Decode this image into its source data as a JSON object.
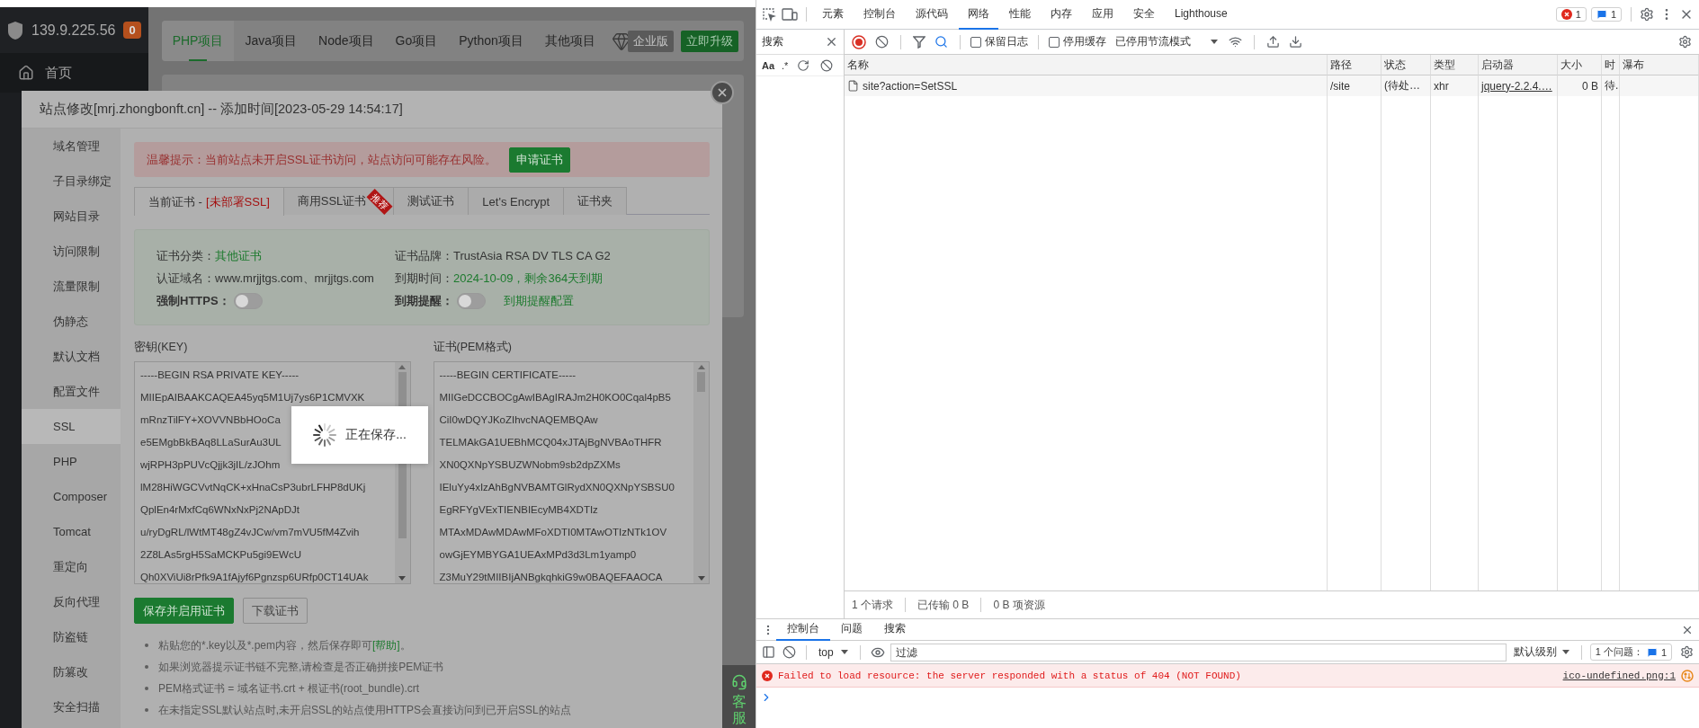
{
  "app": {
    "server_ip": "139.9.225.56",
    "alert_count": "0",
    "nav": [
      {
        "label": "首页"
      }
    ],
    "project_tabs": [
      {
        "label": "PHP项目",
        "selected": true
      },
      {
        "label": "Java项目",
        "selected": false
      },
      {
        "label": "Node项目",
        "selected": false
      },
      {
        "label": "Go项目",
        "selected": false
      },
      {
        "label": "Python项目",
        "selected": false
      },
      {
        "label": "其他项目",
        "selected": false
      }
    ],
    "edition": "企业版",
    "upgrade_button": "立即升级",
    "support": "客服"
  },
  "dialog": {
    "title": "站点修改[mrj.zhongbonft.cn] -- 添加时间[2023-05-29 14:54:17]",
    "menu": [
      {
        "label": "域名管理",
        "selected": false
      },
      {
        "label": "子目录绑定",
        "selected": false
      },
      {
        "label": "网站目录",
        "selected": false
      },
      {
        "label": "访问限制",
        "selected": false
      },
      {
        "label": "流量限制",
        "selected": false
      },
      {
        "label": "伪静态",
        "selected": false
      },
      {
        "label": "默认文档",
        "selected": false
      },
      {
        "label": "配置文件",
        "selected": false
      },
      {
        "label": "SSL",
        "selected": true
      },
      {
        "label": "PHP",
        "selected": false
      },
      {
        "label": "Composer",
        "selected": false
      },
      {
        "label": "Tomcat",
        "selected": false
      },
      {
        "label": "重定向",
        "selected": false
      },
      {
        "label": "反向代理",
        "selected": false
      },
      {
        "label": "防盗链",
        "selected": false
      },
      {
        "label": "防篡改",
        "selected": false
      },
      {
        "label": "安全扫描",
        "selected": false
      }
    ],
    "warning": {
      "text": "温馨提示：当前站点未开启SSL证书访问，站点访问可能存在风险。",
      "button": "申请证书"
    },
    "cert_tabs": [
      {
        "label": "当前证书 -",
        "status": "[未部署SSL]",
        "selected": true
      },
      {
        "label": "商用SSL证书",
        "badge": "推荐",
        "selected": false
      },
      {
        "label": "测试证书",
        "selected": false
      },
      {
        "label": "Let's Encrypt",
        "selected": false
      },
      {
        "label": "证书夹",
        "selected": false
      }
    ],
    "cert_info": [
      {
        "kind": "status",
        "label": "证书分类：",
        "value": "其他证书"
      },
      {
        "kind": "value",
        "label": "证书品牌：",
        "value": "TrustAsia RSA DV TLS CA G2"
      },
      {
        "kind": "value",
        "label": "认证域名：",
        "value": "www.mrjjtgs.com、mrjjtgs.com"
      },
      {
        "kind": "status",
        "label": "到期时间：",
        "value": "2024-10-09，剩余364天到期"
      },
      {
        "kind": "toggle",
        "label": "强制HTTPS：",
        "on": false
      },
      {
        "kind": "toggle",
        "label": "到期提醒：",
        "on": false,
        "link": "到期提醒配置"
      }
    ],
    "key": {
      "label": "密钥(KEY)",
      "lines": [
        "-----BEGIN RSA PRIVATE KEY-----",
        "MIIEpAIBAAKCAQEA45yq5M1Uj7ys6P1CMVXK",
        "mRnzTilFY+XOVVNBbHOoCa",
        "e5EMgbBkBAq8LLaSurAu3UL",
        "wjRPH3pPUVcQjjk3jIL/zJOhm",
        "lM28HiWGCVvtNqCK+xHnaCsP3ubrLFHP8dUKj",
        "QplEn4rMxfCq6WNxNxPj2NApDJt",
        "u/ryDgRL/lWtMT48gZ4vJCw/vm7mVU5fM4Zvih",
        "2Z8LAs5rgH5SaMCKPu5gi9EWcU",
        "Qh0XViUi8rPfk9A1fAjyf6Pgnzsp6URfp0CT14UAk"
      ]
    },
    "certificate": {
      "label": "证书(PEM格式)",
      "lines": [
        "-----BEGIN CERTIFICATE-----",
        "MIIGeDCCBOCgAwIBAgIRAJm2H0KO0Cqal4pB5",
        "CiI0wDQYJKoZIhvcNAQEMBQAw",
        "TELMAkGA1UEBhMCQ04xJTAjBgNVBAoTHFR",
        "XN0QXNpYSBUZWNobm9sb2dpZXMs",
        "IEluYy4xIzAhBgNVBAMTGlRydXN0QXNpYSBSU0",
        "EgRFYgVExTIENBIEcyMB4XDTIz",
        "MTAxMDAwMDAwMFoXDTI0MTAwOTIzNTk1OV",
        "owGjEYMBYGA1UEAxMPd3d3Lm1yamp0",
        "Z3MuY29tMIIBIjANBgkqhkiG9w0BAQEFAAOCA"
      ]
    },
    "buttons": [
      {
        "label": "保存并启用证书",
        "kind": "primary"
      },
      {
        "label": "下载证书",
        "kind": "secondary"
      }
    ],
    "notes": [
      {
        "text": "粘贴您的*.key以及*.pem内容，然后保存即可",
        "link": "[帮助]",
        "after": "。"
      },
      {
        "text": "如果浏览器提示证书链不完整,请检查是否正确拼接PEM证书"
      },
      {
        "text": "PEM格式证书 = 域名证书.crt + 根证书(root_bundle).crt"
      },
      {
        "text": "在未指定SSL默认站点时,未开启SSL的站点使用HTTPS会直接访问到已开启SSL的站点"
      }
    ]
  },
  "toast": {
    "text": "正在保存..."
  },
  "devtools": {
    "panel_tabs": [
      {
        "label": "元素",
        "selected": false
      },
      {
        "label": "控制台",
        "selected": false
      },
      {
        "label": "源代码",
        "selected": false
      },
      {
        "label": "网络",
        "selected": true
      },
      {
        "label": "性能",
        "selected": false
      },
      {
        "label": "内存",
        "selected": false
      },
      {
        "label": "应用",
        "selected": false
      },
      {
        "label": "安全",
        "selected": false
      },
      {
        "label": "Lighthouse",
        "selected": false
      }
    ],
    "error_count": "1",
    "message_count": "1",
    "search_panel": {
      "title": "搜索",
      "match_case": "Aa",
      "regex": ".*"
    },
    "network_toolbar": {
      "preserve_log": {
        "label": "保留日志",
        "checked": false
      },
      "disable_cache": {
        "label": "停用缓存",
        "checked": false
      },
      "throttling": "已停用节流模式"
    },
    "columns": [
      "名称",
      "路径",
      "状态",
      "类型",
      "启动器",
      "大小",
      "时",
      "瀑布"
    ],
    "rows": [
      {
        "cells": [
          "site?action=SetSSL",
          "/site",
          "(待处…",
          "xhr",
          "jquery-2.2.4.…",
          "0 B",
          "待."
        ]
      }
    ],
    "summary": [
      "1 个请求",
      "已传输 0 B",
      "0 B 项资源"
    ],
    "drawer_tabs": [
      {
        "label": "控制台",
        "selected": true
      },
      {
        "label": "问题",
        "selected": false
      },
      {
        "label": "搜索",
        "selected": false
      }
    ],
    "console_toolbar": {
      "context": "top",
      "filter_placeholder": "过滤",
      "levels": "默认级别",
      "issues": "1 个问题：",
      "issue_count": "1"
    },
    "messages": [
      {
        "kind": "error",
        "text": "Failed to load resource: the server responded with a status of 404 (NOT FOUND)",
        "source": "ico-undefined.png:1"
      }
    ]
  }
}
